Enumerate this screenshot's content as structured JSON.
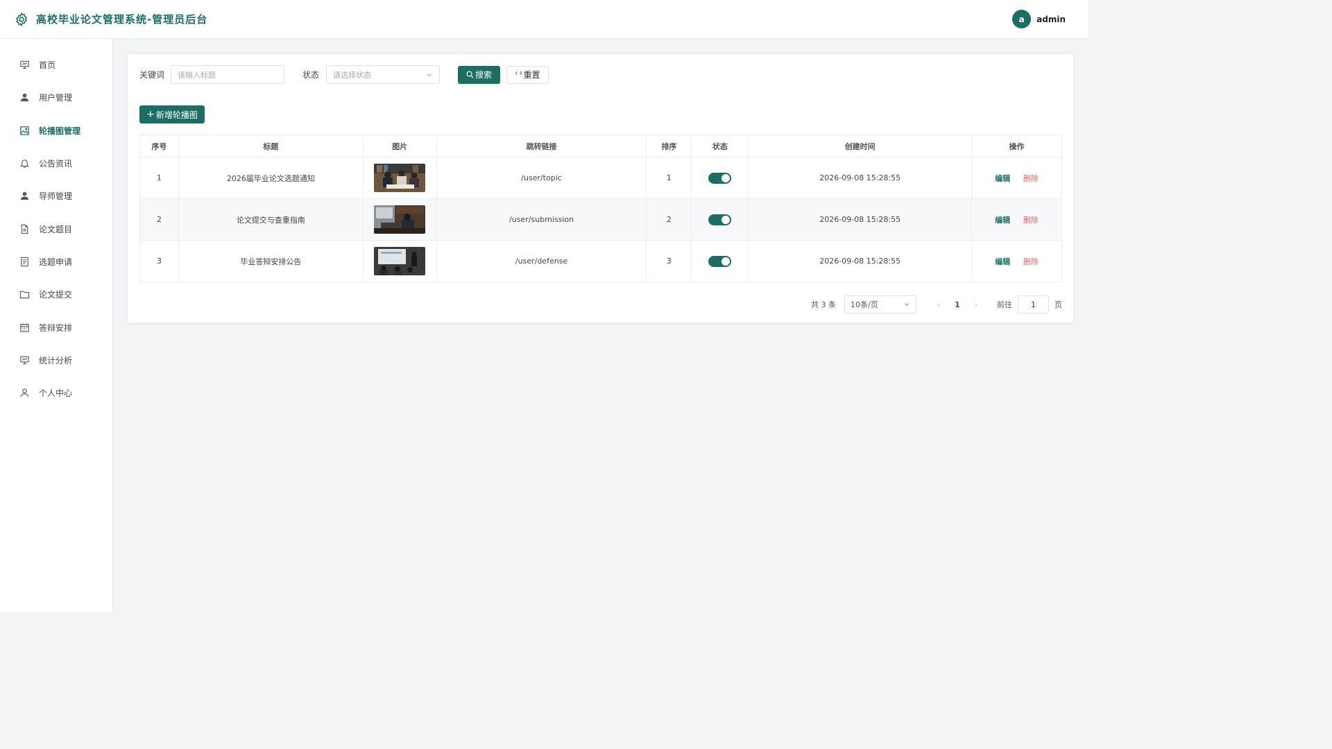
{
  "header": {
    "title": "高校毕业论文管理系统-管理员后台",
    "avatar_letter": "a",
    "username": "admin"
  },
  "sidebar": {
    "items": [
      {
        "label": "首页",
        "icon": "presentation-board-icon"
      },
      {
        "label": "用户管理",
        "icon": "user-icon"
      },
      {
        "label": "轮播图管理",
        "icon": "image-icon",
        "active": true
      },
      {
        "label": "公告资讯",
        "icon": "bell-icon"
      },
      {
        "label": "导师管理",
        "icon": "user-icon"
      },
      {
        "label": "论文题目",
        "icon": "document-icon"
      },
      {
        "label": "选题申请",
        "icon": "list-document-icon"
      },
      {
        "label": "论文提交",
        "icon": "folder-icon"
      },
      {
        "label": "答辩安排",
        "icon": "calendar-icon"
      },
      {
        "label": "统计分析",
        "icon": "presentation-board-icon"
      },
      {
        "label": "个人中心",
        "icon": "user-outline-icon"
      }
    ]
  },
  "filter": {
    "keyword_label": "关键词",
    "keyword_placeholder": "请输入标题",
    "status_label": "状态",
    "status_placeholder": "请选择状态",
    "search_label": "搜索",
    "reset_label": "重置"
  },
  "toolbar": {
    "add_label": "新增轮播图"
  },
  "table": {
    "headers": [
      "序号",
      "标题",
      "图片",
      "跳转链接",
      "排序",
      "状态",
      "创建时间",
      "操作"
    ],
    "rows": [
      {
        "index": "1",
        "title": "2026届毕业论文选题通知",
        "link": "/user/topic",
        "sort": "1",
        "status": true,
        "created": "2026-09-08 15:28:55"
      },
      {
        "index": "2",
        "title": "论文提交与查重指南",
        "link": "/user/submission",
        "sort": "2",
        "status": true,
        "created": "2026-09-08 15:28:55"
      },
      {
        "index": "3",
        "title": "毕业答辩安排公告",
        "link": "/user/defense",
        "sort": "3",
        "status": true,
        "created": "2026-09-08 15:28:55"
      }
    ],
    "edit_label": "编辑",
    "delete_label": "删除"
  },
  "pagination": {
    "total_text": "共 3 条",
    "page_size": "10条/页",
    "current_page": "1",
    "goto_label": "前往",
    "goto_value": "1",
    "page_suffix": "页"
  },
  "colors": {
    "primary": "#1a6e63",
    "danger": "#e06767"
  }
}
